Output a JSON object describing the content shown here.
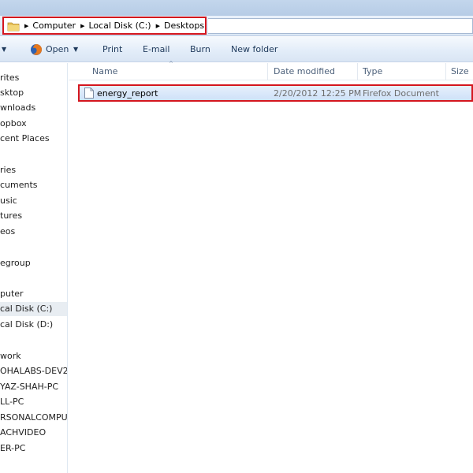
{
  "address": {
    "crumbs": [
      "Computer",
      "Local Disk (C:)",
      "Desktops"
    ],
    "folder_icon": "folder-icon"
  },
  "toolbar": {
    "open_label": "Open",
    "print_label": "Print",
    "email_label": "E-mail",
    "burn_label": "Burn",
    "new_folder_label": "New folder"
  },
  "nav": {
    "items": [
      "rites",
      "sktop",
      "wnloads",
      "opbox",
      "cent Places",
      "ries",
      "cuments",
      "usic",
      "tures",
      "eos",
      "egroup",
      "puter",
      "cal Disk (C:)",
      "cal Disk (D:)",
      "work",
      "OHALABS-DEV2",
      "YAZ-SHAH-PC",
      "LL-PC",
      "RSONALCOMPUT",
      "ACHVIDEO",
      "ER-PC"
    ],
    "selected_index": 12
  },
  "columns": {
    "name": "Name",
    "date": "Date modified",
    "type": "Type",
    "size": "Size"
  },
  "files": [
    {
      "name": "energy_report",
      "date": "2/20/2012 12:25 PM",
      "type": "Firefox Document",
      "size": ""
    }
  ],
  "colors": {
    "highlight_border": "#d4161e",
    "selection_fill": "#cfe1f8",
    "toolbar_text": "#1e395b"
  }
}
